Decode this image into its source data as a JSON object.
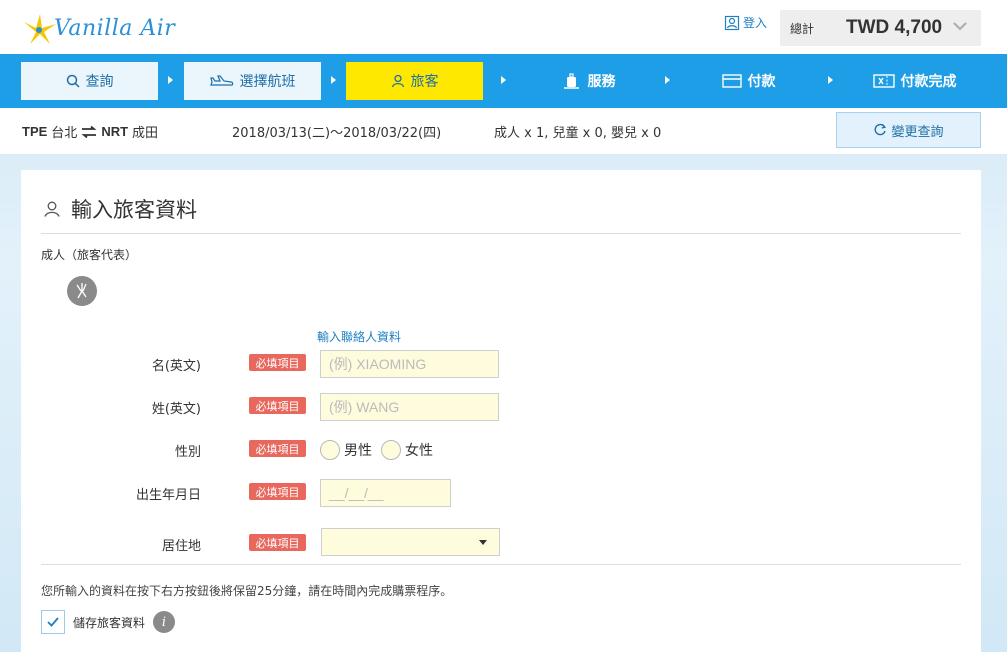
{
  "header": {
    "logo_text": "Vanilla Air",
    "login_label": "登入",
    "total_label": "總計",
    "total_value": "TWD 4,700"
  },
  "nav": {
    "steps": [
      {
        "label": "查詢",
        "icon": "search-icon",
        "state": "done"
      },
      {
        "label": "選擇航班",
        "icon": "plane-icon",
        "state": "done"
      },
      {
        "label": "旅客",
        "icon": "person-icon",
        "state": "active"
      },
      {
        "label": "服務",
        "icon": "luggage-icon",
        "state": "todo"
      },
      {
        "label": "付款",
        "icon": "card-icon",
        "state": "todo"
      },
      {
        "label": "付款完成",
        "icon": "ticket-icon",
        "state": "todo"
      }
    ]
  },
  "search_summary": {
    "origin_code": "TPE",
    "origin_name": "台北",
    "dest_code": "NRT",
    "dest_name": "成田",
    "dates": "2018/03/13(二)～2018/03/22(四)",
    "passengers": "成人 x 1,  兒童 x 0,  嬰兒 x 0",
    "change_button": "變更查詢"
  },
  "form": {
    "title": "輸入旅客資料",
    "section_label": "成人（旅客代表）",
    "contact_link": "輸入聯絡人資料",
    "required_badge": "必填項目",
    "fields": {
      "first_name": {
        "label": "名(英文)",
        "placeholder": "(例) XIAOMING"
      },
      "last_name": {
        "label": "姓(英文)",
        "placeholder": "(例) WANG"
      },
      "gender": {
        "label": "性別",
        "options": [
          "男性",
          "女性"
        ]
      },
      "birthdate": {
        "label": "出生年月日",
        "placeholder": "__/__/__"
      },
      "residence": {
        "label": "居住地",
        "value": ""
      }
    },
    "notice": "您所輸入的資料在按下右方按鈕後將保留25分鐘，請在時間內完成購票程序。",
    "save_label": "儲存旅客資料",
    "save_checked": true
  },
  "colors": {
    "nav_bg": "#1d9ee6",
    "active_step": "#ffe800",
    "required_badge": "#e8685e",
    "input_bg": "#fffbdd",
    "link": "#1e7fc3"
  }
}
